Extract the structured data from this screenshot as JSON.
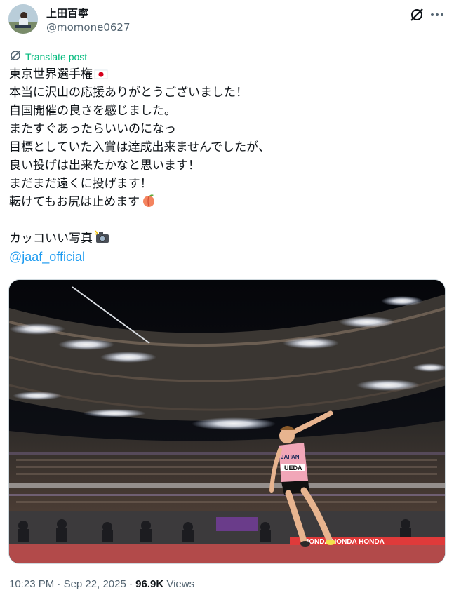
{
  "author": {
    "display_name": "上田百寧",
    "handle": "@momone0627"
  },
  "actions": {
    "grok_icon": "grok-icon",
    "more_icon": "more-icon"
  },
  "translate": {
    "label": "Translate post"
  },
  "post": {
    "lines": [
      "東京世界選手権",
      "本当に沢山の応援ありがとうございました！",
      "自国開催の良さを感じました。",
      "またすぐあったらいいのになっ",
      "目標としていた入賞は達成出来ませんでしたが、",
      "良い投げは出来たかなと思います！",
      "まだまだ遠くに投げます！",
      "転けてもお尻は止めます",
      "",
      "カッコいい写真"
    ],
    "mention": "@jaaf_official"
  },
  "media": {
    "bib_country": "JAPAN",
    "bib_name": "UEDA",
    "banner_text": "HONDA HONDA HONDA"
  },
  "meta": {
    "time": "10:23 PM",
    "separator1": "·",
    "date": "Sep 22, 2025",
    "separator2": "·",
    "views_count": "96.9K",
    "views_label": "Views"
  },
  "colors": {
    "accent": "#1d9bf0",
    "translate_green": "#00ba7c",
    "secondary_text": "#536471",
    "track": "#b24a4a"
  }
}
